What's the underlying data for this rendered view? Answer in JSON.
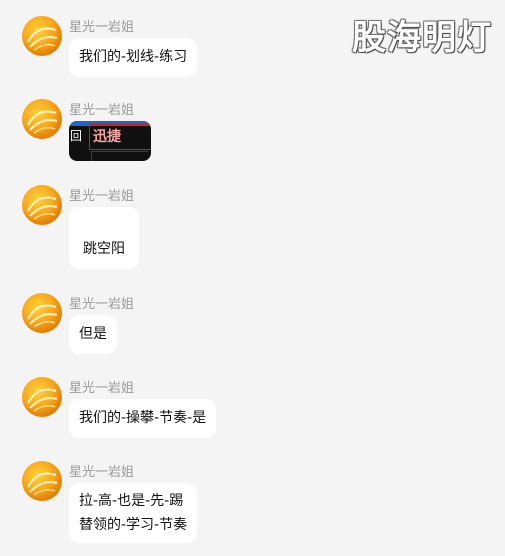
{
  "watermark": "股海明灯",
  "messages": [
    {
      "sender": "星光一岩姐",
      "text": "我们的-划线-练习"
    },
    {
      "sender": "星光一岩姐",
      "image": {
        "left_text": "回",
        "title": "迅捷"
      }
    },
    {
      "sender": "星光一岩姐",
      "text": "跳空阳"
    },
    {
      "sender": "星光一岩姐",
      "text": "但是"
    },
    {
      "sender": "星光一岩姐",
      "text": "我们的-操攀-节奏-是"
    },
    {
      "sender": "星光一岩姐",
      "lines": [
        "拉-高-也是-先-踢",
        "替领的-学习-节奏"
      ]
    }
  ]
}
